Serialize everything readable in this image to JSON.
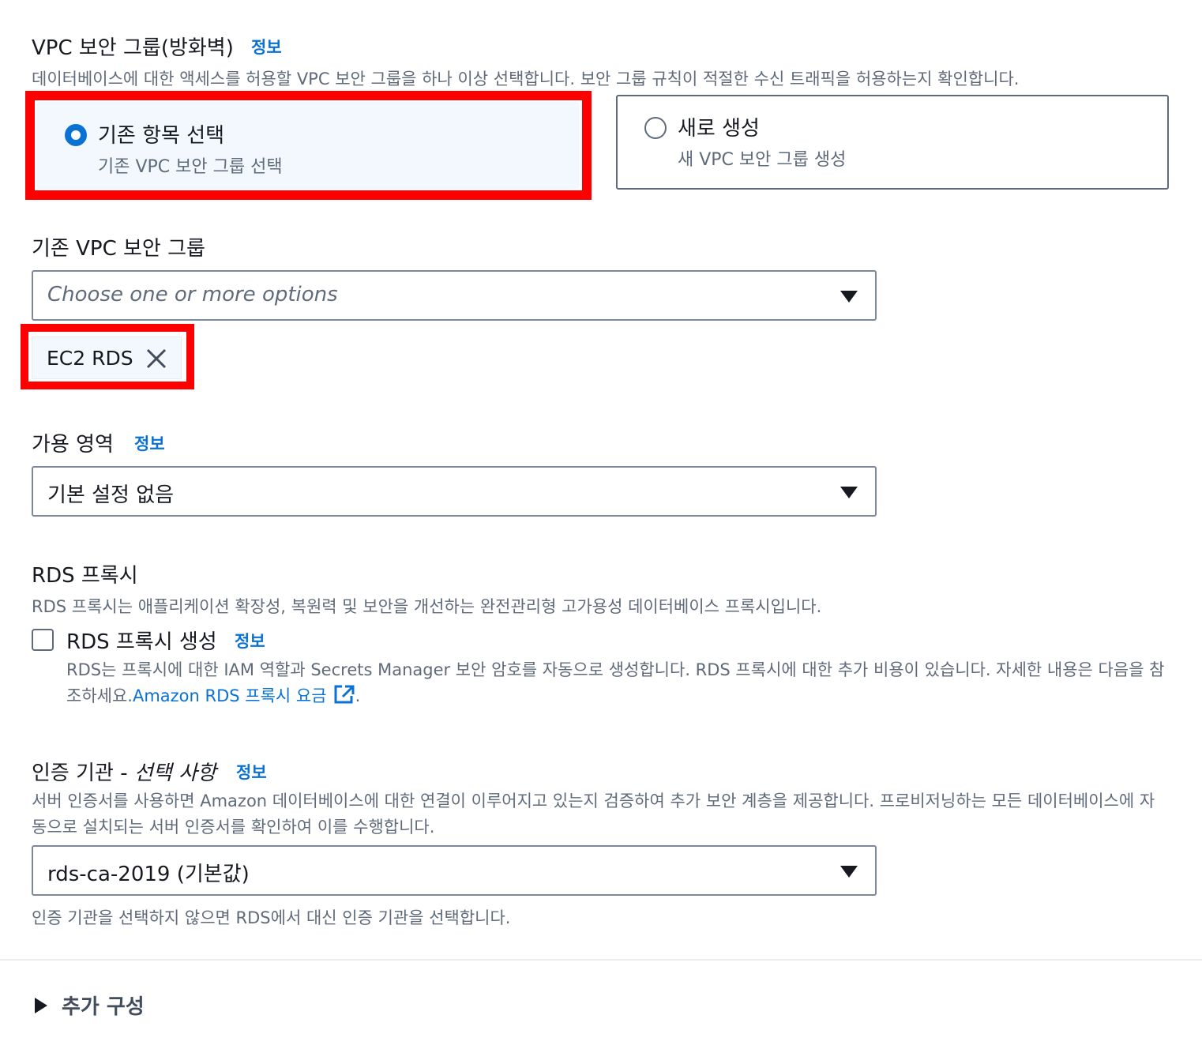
{
  "vpc_sg": {
    "heading": "VPC 보안 그룹(방화벽)",
    "info": "정보",
    "description": "데이터베이스에 대한 액세스를 허용할 VPC 보안 그룹을 하나 이상 선택합니다. 보안 그룹 규칙이 적절한 수신 트래픽을 허용하는지 확인합니다.",
    "options": [
      {
        "title": "기존 항목 선택",
        "subtitle": "기존 VPC 보안 그룹 선택",
        "selected": true
      },
      {
        "title": "새로 생성",
        "subtitle": "새 VPC 보안 그룹 생성",
        "selected": false
      }
    ]
  },
  "existing_sg": {
    "label": "기존 VPC 보안 그룹",
    "placeholder": "Choose one or more options",
    "tokens": [
      "EC2 RDS"
    ]
  },
  "az": {
    "label": "가용 영역",
    "info": "정보",
    "value": "기본 설정 없음"
  },
  "rds_proxy": {
    "heading": "RDS 프록시",
    "description": "RDS 프록시는 애플리케이션 확장성, 복원력 및 보안을 개선하는 완전관리형 고가용성 데이터베이스 프록시입니다.",
    "checkbox_label": "RDS 프록시 생성",
    "checked": false,
    "info": "정보",
    "detail_prefix": "RDS는 프록시에 대한 IAM 역할과 Secrets Manager 보안 암호를 자동으로 생성합니다. RDS 프록시에 대한 추가 비용이 있습니다. 자세한 내용은 다음을 참조하세요.",
    "detail_link": "Amazon RDS 프록시 요금",
    "detail_suffix": "."
  },
  "ca": {
    "label": "인증 기관 - ",
    "label_optional": "선택 사항",
    "info": "정보",
    "description": "서버 인증서를 사용하면 Amazon 데이터베이스에 대한 연결이 이루어지고 있는지 검증하여 추가 보안 계층을 제공합니다. 프로비저닝하는 모든 데이터베이스에 자동으로 설치되는 서버 인증서를 확인하여 이를 수행합니다.",
    "value": "rds-ca-2019 (기본값)",
    "hint": "인증 기관을 선택하지 않으면 RDS에서 대신 인증 기관을 선택합니다."
  },
  "additional_config": {
    "label": "추가 구성"
  },
  "colors": {
    "accent": "#0972d3",
    "highlight": "#ff0000",
    "selected_tile_bg": "#f2f8fd"
  }
}
